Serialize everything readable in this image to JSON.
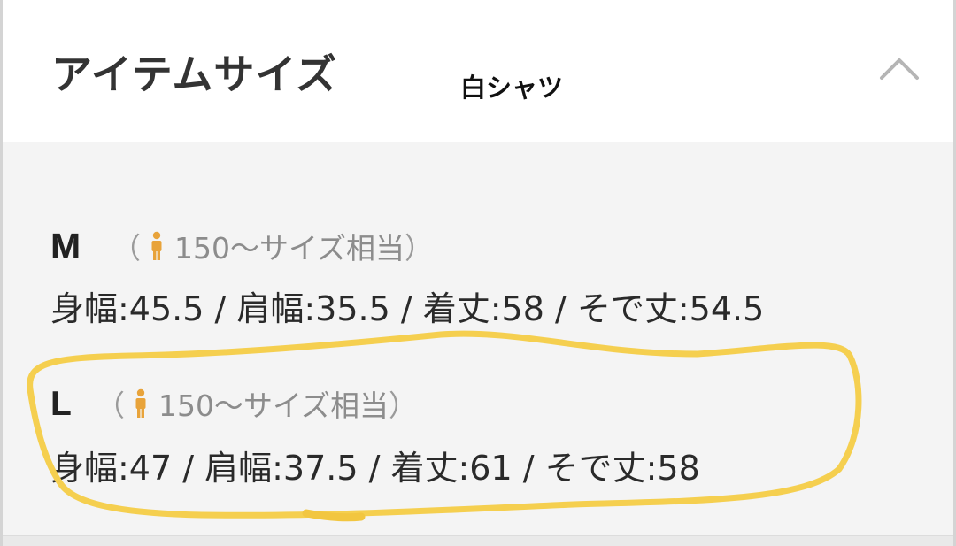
{
  "section": {
    "title": "アイテムサイズ",
    "note": "白シャツ",
    "collapse_icon": "chevron-up-icon"
  },
  "sizes": [
    {
      "size": "M",
      "note_open": "（",
      "note_icon": "person-icon",
      "note_text": "150〜サイズ相当",
      "note_close": "）",
      "measurements": "身幅:45.5 / 肩幅:35.5 / 着丈:58 / そで丈:54.5"
    },
    {
      "size": "L",
      "note_open": "（",
      "note_icon": "person-icon",
      "note_text": "150〜サイズ相当",
      "note_close": "）",
      "measurements": "身幅:47 / 肩幅:37.5 / 着丈:61 / そで丈:58"
    }
  ],
  "colors": {
    "accent_icon": "#e8a33a",
    "highlight_marker": "#f5cf4f",
    "panel_background": "#f4f4f4"
  }
}
